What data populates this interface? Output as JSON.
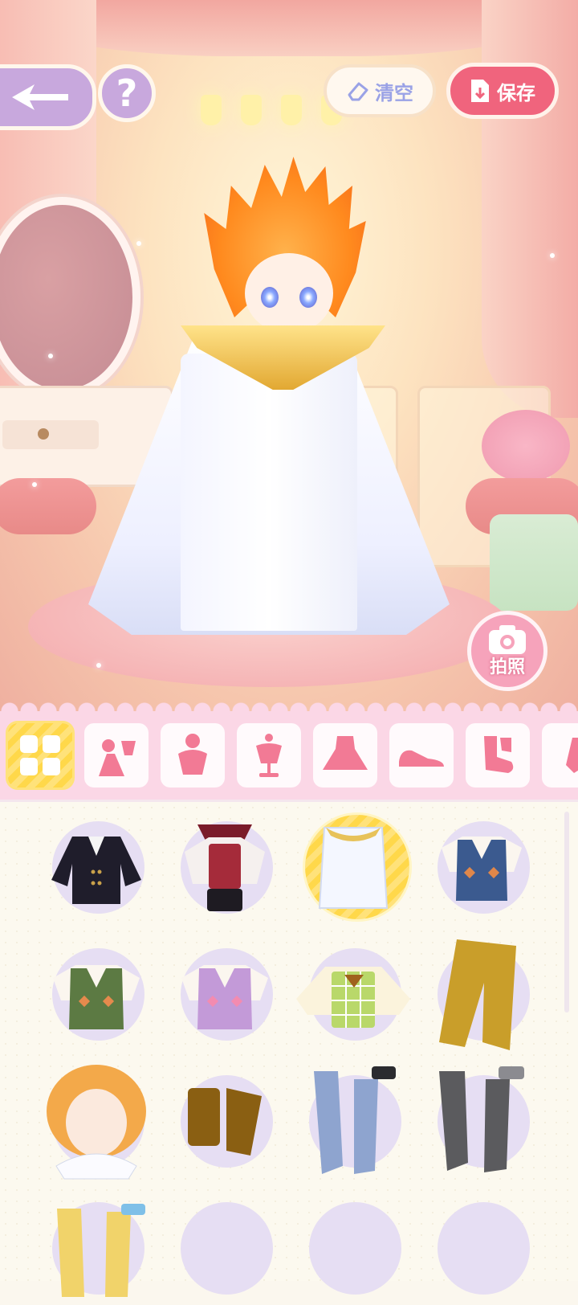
{
  "top_bar": {
    "clear_label": "清空",
    "save_label": "保存",
    "help_label": "?"
  },
  "photo_button": {
    "label": "拍照"
  },
  "categories": [
    {
      "name": "all",
      "icon": "grid-icon",
      "active": true
    },
    {
      "name": "outfit-set",
      "icon": "dress-set-icon"
    },
    {
      "name": "top",
      "icon": "torso-icon"
    },
    {
      "name": "accessory",
      "icon": "mannequin-icon"
    },
    {
      "name": "dress",
      "icon": "dress-icon"
    },
    {
      "name": "shoes",
      "icon": "shoe-icon"
    },
    {
      "name": "socks",
      "icon": "sock-icon"
    },
    {
      "name": "more",
      "icon": "partial-icon"
    }
  ],
  "items": [
    {
      "name": "black-coat",
      "color": "#1f1d2b"
    },
    {
      "name": "vampire-outfit",
      "color": "#a52b3a"
    },
    {
      "name": "white-robe",
      "color": "#f4f7ff",
      "selected": true
    },
    {
      "name": "blue-argyle-vest",
      "color": "#3b5a8f"
    },
    {
      "name": "green-argyle-vest",
      "color": "#5c7a43"
    },
    {
      "name": "purple-argyle-vest",
      "color": "#c39ad8"
    },
    {
      "name": "plaid-vest-shirt",
      "color": "#b9d86a"
    },
    {
      "name": "mustard-pants",
      "color": "#c99e2a"
    },
    {
      "name": "blonde-hair",
      "color": "#f3a94a"
    },
    {
      "name": "brown-boots",
      "color": "#8a5f12"
    },
    {
      "name": "blue-argyle-socks",
      "color": "#8ea4cf"
    },
    {
      "name": "gray-argyle-socks",
      "color": "#5b5b5e"
    },
    {
      "name": "yellow-argyle-socks",
      "color": "#f1d36a"
    },
    {
      "name": "item-14",
      "color": "#3b3b4a"
    },
    {
      "name": "item-15",
      "color": "#3b3b4a"
    },
    {
      "name": "item-16",
      "color": "#3b3b4a"
    }
  ]
}
